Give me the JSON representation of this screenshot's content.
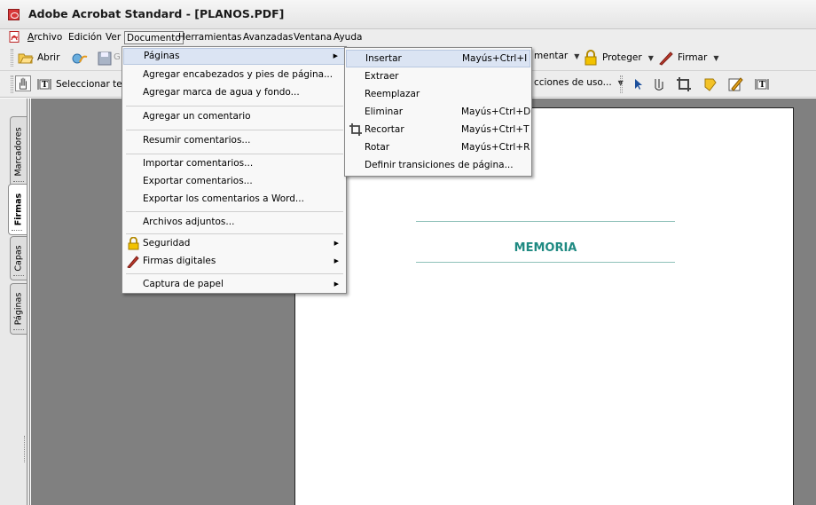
{
  "window": {
    "title": "Adobe Acrobat Standard - [PLANOS.PDF]"
  },
  "menubar": {
    "items": [
      "Archivo",
      "Edición",
      "Ver",
      "Documento",
      "Herramientas",
      "Avanzadas",
      "Ventana",
      "Ayuda"
    ],
    "active": "Documento"
  },
  "toolbar1": {
    "open_label": "Abrir",
    "comment_label": "mentar",
    "protect_label": "Proteger",
    "sign_label": "Firmar"
  },
  "toolbar2": {
    "select_label": "Seleccionar te",
    "usage_label": "cciones de uso..."
  },
  "leftpane": {
    "tabs": [
      "Marcadores",
      "Firmas",
      "Capas",
      "Páginas"
    ],
    "active": "Firmas"
  },
  "document": {
    "heading": "MEMORIA"
  },
  "documento_menu": {
    "items": [
      {
        "label": "Páginas"
      },
      {
        "label": "Agregar encabezados y pies de página..."
      },
      {
        "label": "Agregar marca de agua y fondo..."
      },
      {
        "label": "Agregar un comentario"
      },
      {
        "label": "Resumir comentarios..."
      },
      {
        "label": "Importar comentarios..."
      },
      {
        "label": "Exportar comentarios..."
      },
      {
        "label": "Exportar los comentarios a Word..."
      },
      {
        "label": "Archivos adjuntos..."
      },
      {
        "label": "Seguridad",
        "icon": "lock-icon"
      },
      {
        "label": "Firmas digitales",
        "icon": "pen-icon"
      },
      {
        "label": "Captura de papel"
      }
    ]
  },
  "paginas_submenu": {
    "items": [
      {
        "label": "Insertar",
        "shortcut": "Mayús+Ctrl+I"
      },
      {
        "label": "Extraer",
        "shortcut": ""
      },
      {
        "label": "Reemplazar",
        "shortcut": ""
      },
      {
        "label": "Eliminar",
        "shortcut": "Mayús+Ctrl+D"
      },
      {
        "label": "Recortar",
        "shortcut": "Mayús+Ctrl+T",
        "icon": "crop-icon"
      },
      {
        "label": "Rotar",
        "shortcut": "Mayús+Ctrl+R"
      },
      {
        "label": "Definir transiciones de página...",
        "shortcut": ""
      }
    ]
  },
  "colors": {
    "highlight": "#dbe4f3",
    "heading": "#1f8a82",
    "rule": "#8fc1b9",
    "doc_background": "#808080"
  }
}
